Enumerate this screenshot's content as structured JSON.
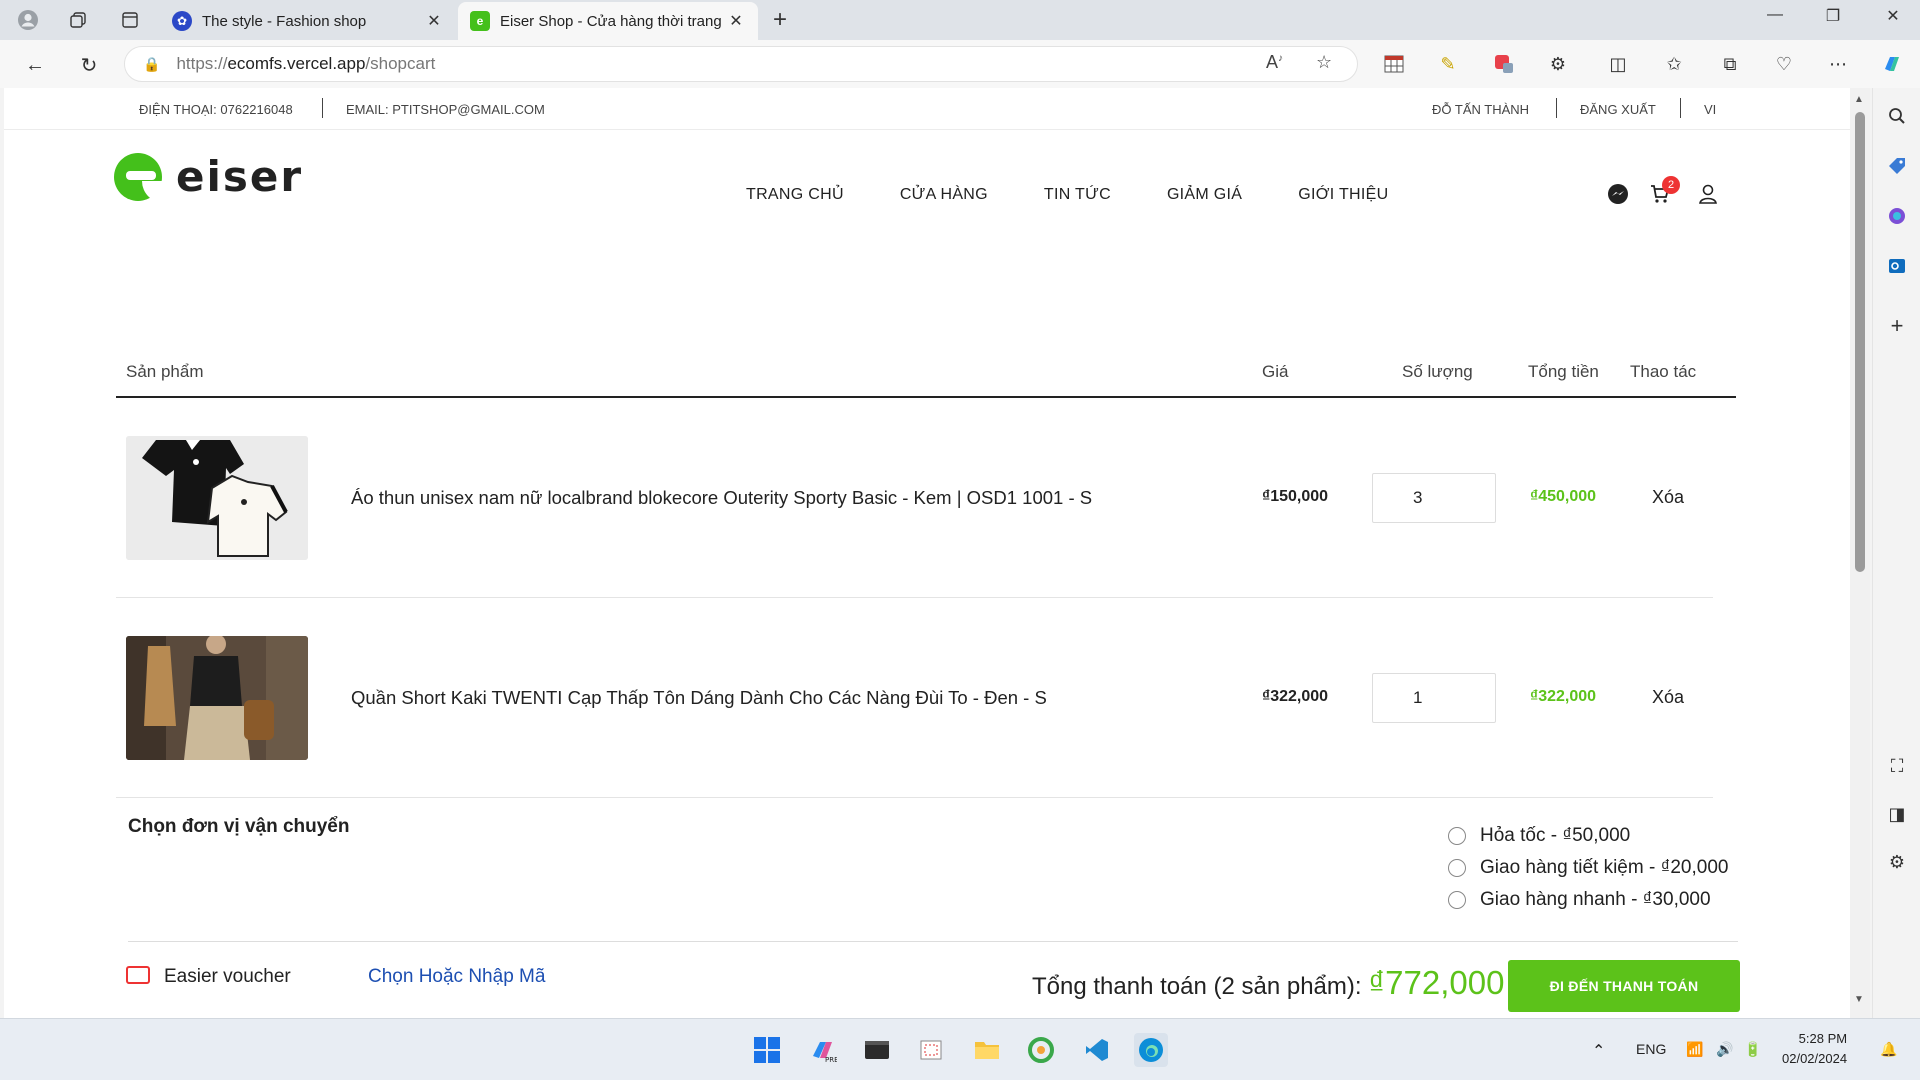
{
  "browser": {
    "tabs": [
      {
        "title": "The style - Fashion shop",
        "active": false
      },
      {
        "title": "Eiser Shop - Cửa hàng thời trang",
        "active": true
      }
    ],
    "url_prefix": "https://",
    "url_host": "ecomfs.vercel.app",
    "url_path": "/shopcart"
  },
  "topbar": {
    "phone": "ĐIỆN THOẠI: 0762216048",
    "email": "EMAIL: PTITSHOP@GMAIL.COM",
    "user": "ĐỖ TẤN THÀNH",
    "logout": "ĐĂNG XUẤT",
    "lang": "VI"
  },
  "header": {
    "logo_text": "eiser",
    "menu": [
      "TRANG CHỦ",
      "CỬA HÀNG",
      "TIN TỨC",
      "GIẢM GIÁ",
      "GIỚI THIỆU"
    ],
    "cart_count": "2"
  },
  "cart": {
    "headers": {
      "product": "Sản phẩm",
      "price": "Giá",
      "qty": "Số lượng",
      "total": "Tổng tiền",
      "action": "Thao tác"
    },
    "items": [
      {
        "name": "Áo thun unisex nam nữ localbrand blokecore Outerity Sporty Basic - Kem | OSD1 1001 - S",
        "price": "₫150,000",
        "qty": "3",
        "total": "₫450,000",
        "delete": "Xóa"
      },
      {
        "name": "Quần Short Kaki TWENTI Cạp Thấp Tôn Dáng Dành Cho Các Nàng Đùi To - Đen - S",
        "price": "₫322,000",
        "qty": "1",
        "total": "₫322,000",
        "delete": "Xóa"
      }
    ],
    "shipping": {
      "label": "Chọn đơn vị vận chuyển",
      "options": [
        "Hỏa tốc - ₫50,000",
        "Giao hàng tiết kiệm - ₫20,000",
        "Giao hàng nhanh - ₫30,000"
      ]
    },
    "voucher": {
      "label": "Easier voucher",
      "link": "Chọn Hoặc Nhập Mã"
    },
    "summary": {
      "label": "Tổng thanh toán (2 sản phẩm):",
      "amount": "₫772,000"
    },
    "checkout": "ĐI ĐẾN THANH TOÁN"
  },
  "taskbar": {
    "lang": "ENG",
    "time": "5:28 PM",
    "date": "02/02/2024"
  },
  "colors": {
    "accent": "#5cc21a",
    "link": "#1d4fb2",
    "badge": "#e33333"
  }
}
